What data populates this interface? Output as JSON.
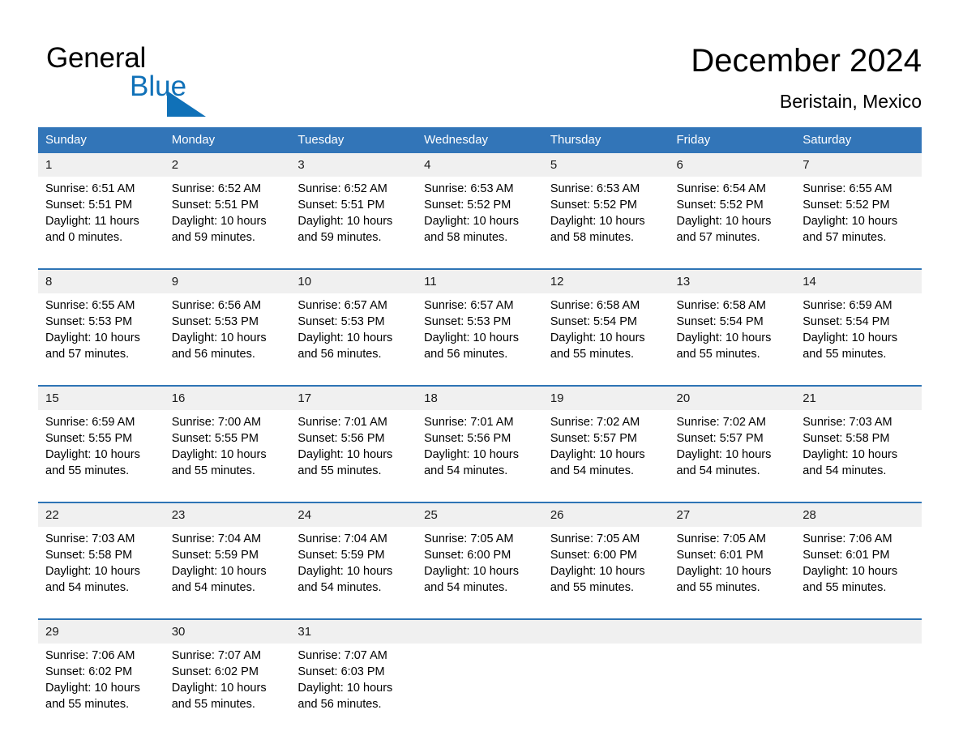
{
  "brand": {
    "name_part1": "General",
    "name_part2": "Blue",
    "accent_color": "#1071b8",
    "triangle_icon": "triangle-icon"
  },
  "header": {
    "title": "December 2024",
    "location": "Beristain, Mexico"
  },
  "calendar": {
    "header_bg": "#3275b8",
    "daynum_bg": "#f0f0f0",
    "weekday_headers": [
      "Sunday",
      "Monday",
      "Tuesday",
      "Wednesday",
      "Thursday",
      "Friday",
      "Saturday"
    ],
    "weeks": [
      [
        {
          "day": "1",
          "sunrise": "Sunrise: 6:51 AM",
          "sunset": "Sunset: 5:51 PM",
          "daylight_line1": "Daylight: 11 hours",
          "daylight_line2": "and 0 minutes."
        },
        {
          "day": "2",
          "sunrise": "Sunrise: 6:52 AM",
          "sunset": "Sunset: 5:51 PM",
          "daylight_line1": "Daylight: 10 hours",
          "daylight_line2": "and 59 minutes."
        },
        {
          "day": "3",
          "sunrise": "Sunrise: 6:52 AM",
          "sunset": "Sunset: 5:51 PM",
          "daylight_line1": "Daylight: 10 hours",
          "daylight_line2": "and 59 minutes."
        },
        {
          "day": "4",
          "sunrise": "Sunrise: 6:53 AM",
          "sunset": "Sunset: 5:52 PM",
          "daylight_line1": "Daylight: 10 hours",
          "daylight_line2": "and 58 minutes."
        },
        {
          "day": "5",
          "sunrise": "Sunrise: 6:53 AM",
          "sunset": "Sunset: 5:52 PM",
          "daylight_line1": "Daylight: 10 hours",
          "daylight_line2": "and 58 minutes."
        },
        {
          "day": "6",
          "sunrise": "Sunrise: 6:54 AM",
          "sunset": "Sunset: 5:52 PM",
          "daylight_line1": "Daylight: 10 hours",
          "daylight_line2": "and 57 minutes."
        },
        {
          "day": "7",
          "sunrise": "Sunrise: 6:55 AM",
          "sunset": "Sunset: 5:52 PM",
          "daylight_line1": "Daylight: 10 hours",
          "daylight_line2": "and 57 minutes."
        }
      ],
      [
        {
          "day": "8",
          "sunrise": "Sunrise: 6:55 AM",
          "sunset": "Sunset: 5:53 PM",
          "daylight_line1": "Daylight: 10 hours",
          "daylight_line2": "and 57 minutes."
        },
        {
          "day": "9",
          "sunrise": "Sunrise: 6:56 AM",
          "sunset": "Sunset: 5:53 PM",
          "daylight_line1": "Daylight: 10 hours",
          "daylight_line2": "and 56 minutes."
        },
        {
          "day": "10",
          "sunrise": "Sunrise: 6:57 AM",
          "sunset": "Sunset: 5:53 PM",
          "daylight_line1": "Daylight: 10 hours",
          "daylight_line2": "and 56 minutes."
        },
        {
          "day": "11",
          "sunrise": "Sunrise: 6:57 AM",
          "sunset": "Sunset: 5:53 PM",
          "daylight_line1": "Daylight: 10 hours",
          "daylight_line2": "and 56 minutes."
        },
        {
          "day": "12",
          "sunrise": "Sunrise: 6:58 AM",
          "sunset": "Sunset: 5:54 PM",
          "daylight_line1": "Daylight: 10 hours",
          "daylight_line2": "and 55 minutes."
        },
        {
          "day": "13",
          "sunrise": "Sunrise: 6:58 AM",
          "sunset": "Sunset: 5:54 PM",
          "daylight_line1": "Daylight: 10 hours",
          "daylight_line2": "and 55 minutes."
        },
        {
          "day": "14",
          "sunrise": "Sunrise: 6:59 AM",
          "sunset": "Sunset: 5:54 PM",
          "daylight_line1": "Daylight: 10 hours",
          "daylight_line2": "and 55 minutes."
        }
      ],
      [
        {
          "day": "15",
          "sunrise": "Sunrise: 6:59 AM",
          "sunset": "Sunset: 5:55 PM",
          "daylight_line1": "Daylight: 10 hours",
          "daylight_line2": "and 55 minutes."
        },
        {
          "day": "16",
          "sunrise": "Sunrise: 7:00 AM",
          "sunset": "Sunset: 5:55 PM",
          "daylight_line1": "Daylight: 10 hours",
          "daylight_line2": "and 55 minutes."
        },
        {
          "day": "17",
          "sunrise": "Sunrise: 7:01 AM",
          "sunset": "Sunset: 5:56 PM",
          "daylight_line1": "Daylight: 10 hours",
          "daylight_line2": "and 55 minutes."
        },
        {
          "day": "18",
          "sunrise": "Sunrise: 7:01 AM",
          "sunset": "Sunset: 5:56 PM",
          "daylight_line1": "Daylight: 10 hours",
          "daylight_line2": "and 54 minutes."
        },
        {
          "day": "19",
          "sunrise": "Sunrise: 7:02 AM",
          "sunset": "Sunset: 5:57 PM",
          "daylight_line1": "Daylight: 10 hours",
          "daylight_line2": "and 54 minutes."
        },
        {
          "day": "20",
          "sunrise": "Sunrise: 7:02 AM",
          "sunset": "Sunset: 5:57 PM",
          "daylight_line1": "Daylight: 10 hours",
          "daylight_line2": "and 54 minutes."
        },
        {
          "day": "21",
          "sunrise": "Sunrise: 7:03 AM",
          "sunset": "Sunset: 5:58 PM",
          "daylight_line1": "Daylight: 10 hours",
          "daylight_line2": "and 54 minutes."
        }
      ],
      [
        {
          "day": "22",
          "sunrise": "Sunrise: 7:03 AM",
          "sunset": "Sunset: 5:58 PM",
          "daylight_line1": "Daylight: 10 hours",
          "daylight_line2": "and 54 minutes."
        },
        {
          "day": "23",
          "sunrise": "Sunrise: 7:04 AM",
          "sunset": "Sunset: 5:59 PM",
          "daylight_line1": "Daylight: 10 hours",
          "daylight_line2": "and 54 minutes."
        },
        {
          "day": "24",
          "sunrise": "Sunrise: 7:04 AM",
          "sunset": "Sunset: 5:59 PM",
          "daylight_line1": "Daylight: 10 hours",
          "daylight_line2": "and 54 minutes."
        },
        {
          "day": "25",
          "sunrise": "Sunrise: 7:05 AM",
          "sunset": "Sunset: 6:00 PM",
          "daylight_line1": "Daylight: 10 hours",
          "daylight_line2": "and 54 minutes."
        },
        {
          "day": "26",
          "sunrise": "Sunrise: 7:05 AM",
          "sunset": "Sunset: 6:00 PM",
          "daylight_line1": "Daylight: 10 hours",
          "daylight_line2": "and 55 minutes."
        },
        {
          "day": "27",
          "sunrise": "Sunrise: 7:05 AM",
          "sunset": "Sunset: 6:01 PM",
          "daylight_line1": "Daylight: 10 hours",
          "daylight_line2": "and 55 minutes."
        },
        {
          "day": "28",
          "sunrise": "Sunrise: 7:06 AM",
          "sunset": "Sunset: 6:01 PM",
          "daylight_line1": "Daylight: 10 hours",
          "daylight_line2": "and 55 minutes."
        }
      ],
      [
        {
          "day": "29",
          "sunrise": "Sunrise: 7:06 AM",
          "sunset": "Sunset: 6:02 PM",
          "daylight_line1": "Daylight: 10 hours",
          "daylight_line2": "and 55 minutes."
        },
        {
          "day": "30",
          "sunrise": "Sunrise: 7:07 AM",
          "sunset": "Sunset: 6:02 PM",
          "daylight_line1": "Daylight: 10 hours",
          "daylight_line2": "and 55 minutes."
        },
        {
          "day": "31",
          "sunrise": "Sunrise: 7:07 AM",
          "sunset": "Sunset: 6:03 PM",
          "daylight_line1": "Daylight: 10 hours",
          "daylight_line2": "and 56 minutes."
        },
        {
          "day": "",
          "sunrise": "",
          "sunset": "",
          "daylight_line1": "",
          "daylight_line2": ""
        },
        {
          "day": "",
          "sunrise": "",
          "sunset": "",
          "daylight_line1": "",
          "daylight_line2": ""
        },
        {
          "day": "",
          "sunrise": "",
          "sunset": "",
          "daylight_line1": "",
          "daylight_line2": ""
        },
        {
          "day": "",
          "sunrise": "",
          "sunset": "",
          "daylight_line1": "",
          "daylight_line2": ""
        }
      ]
    ]
  }
}
